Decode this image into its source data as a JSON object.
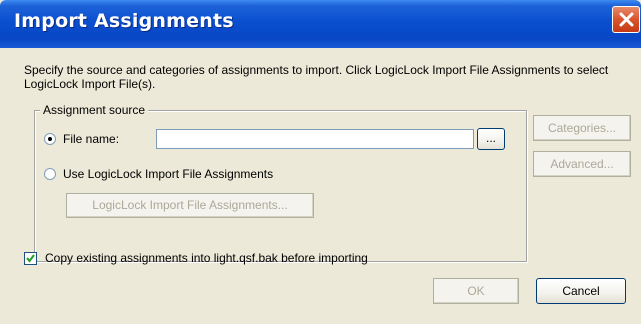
{
  "window": {
    "title": "Import Assignments"
  },
  "description": "Specify the source and categories of assignments to import. Click LogicLock Import File Assignments to select LogicLock Import File(s).",
  "assignment_source": {
    "legend": "Assignment source",
    "file_name_label": "File name:",
    "file_name_value": "",
    "file_name_selected": true,
    "browse_label": "...",
    "logiclock_option_label": "Use LogicLock Import File Assignments",
    "logiclock_button_label": "LogicLock Import File Assignments..."
  },
  "side_buttons": {
    "categories": "Categories...",
    "advanced": "Advanced..."
  },
  "copy_option": {
    "label": "Copy existing assignments into light.qsf.bak before importing",
    "checked": true
  },
  "footer": {
    "ok": "OK",
    "cancel": "Cancel"
  }
}
